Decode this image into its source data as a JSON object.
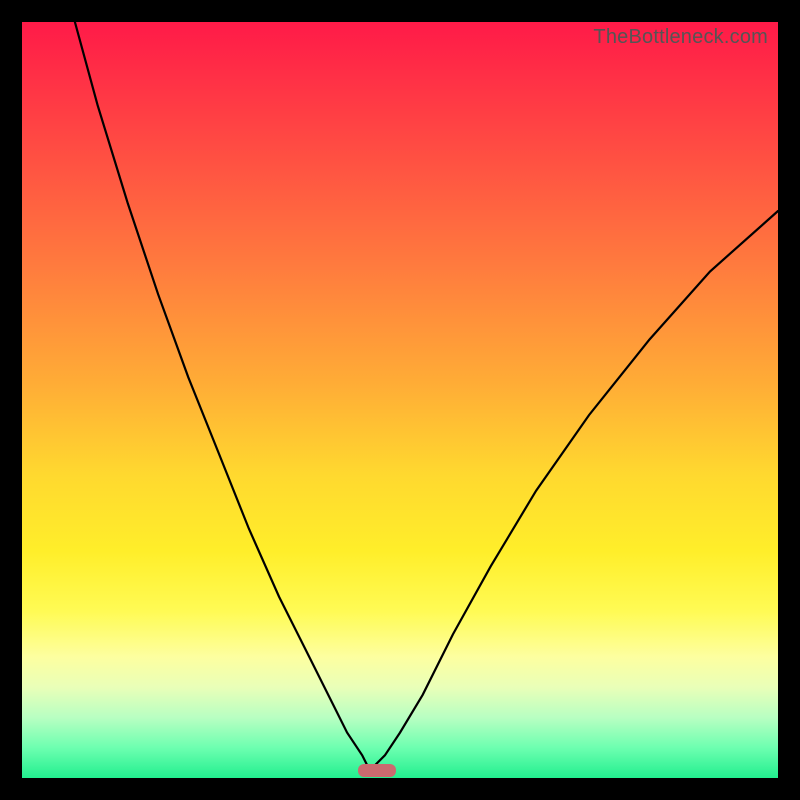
{
  "watermark": "TheBottleneck.com",
  "colors": {
    "top": "#ff1a48",
    "mid1": "#ff7a3e",
    "mid2": "#ffd92f",
    "mid3": "#fffb55",
    "bottom": "#22ef8f",
    "curve": "#000000",
    "marker": "#cb6a6f",
    "frame": "#000000"
  },
  "chart_data": {
    "type": "line",
    "title": "",
    "xlabel": "",
    "ylabel": "",
    "xlim": [
      0,
      100
    ],
    "ylim": [
      0,
      100
    ],
    "grid": false,
    "legend": false,
    "optimum_x": 46,
    "marker": {
      "x0": 44.5,
      "x1": 49.5,
      "y": 1.0,
      "height": 1.8
    },
    "series": [
      {
        "name": "left-branch",
        "x": [
          7,
          10,
          14,
          18,
          22,
          26,
          30,
          34,
          38,
          41,
          43,
          45,
          46
        ],
        "y": [
          100,
          89,
          76,
          64,
          53,
          43,
          33,
          24,
          16,
          10,
          6,
          3,
          1
        ]
      },
      {
        "name": "right-branch",
        "x": [
          46,
          48,
          50,
          53,
          57,
          62,
          68,
          75,
          83,
          91,
          100
        ],
        "y": [
          1,
          3,
          6,
          11,
          19,
          28,
          38,
          48,
          58,
          67,
          75
        ]
      }
    ]
  }
}
